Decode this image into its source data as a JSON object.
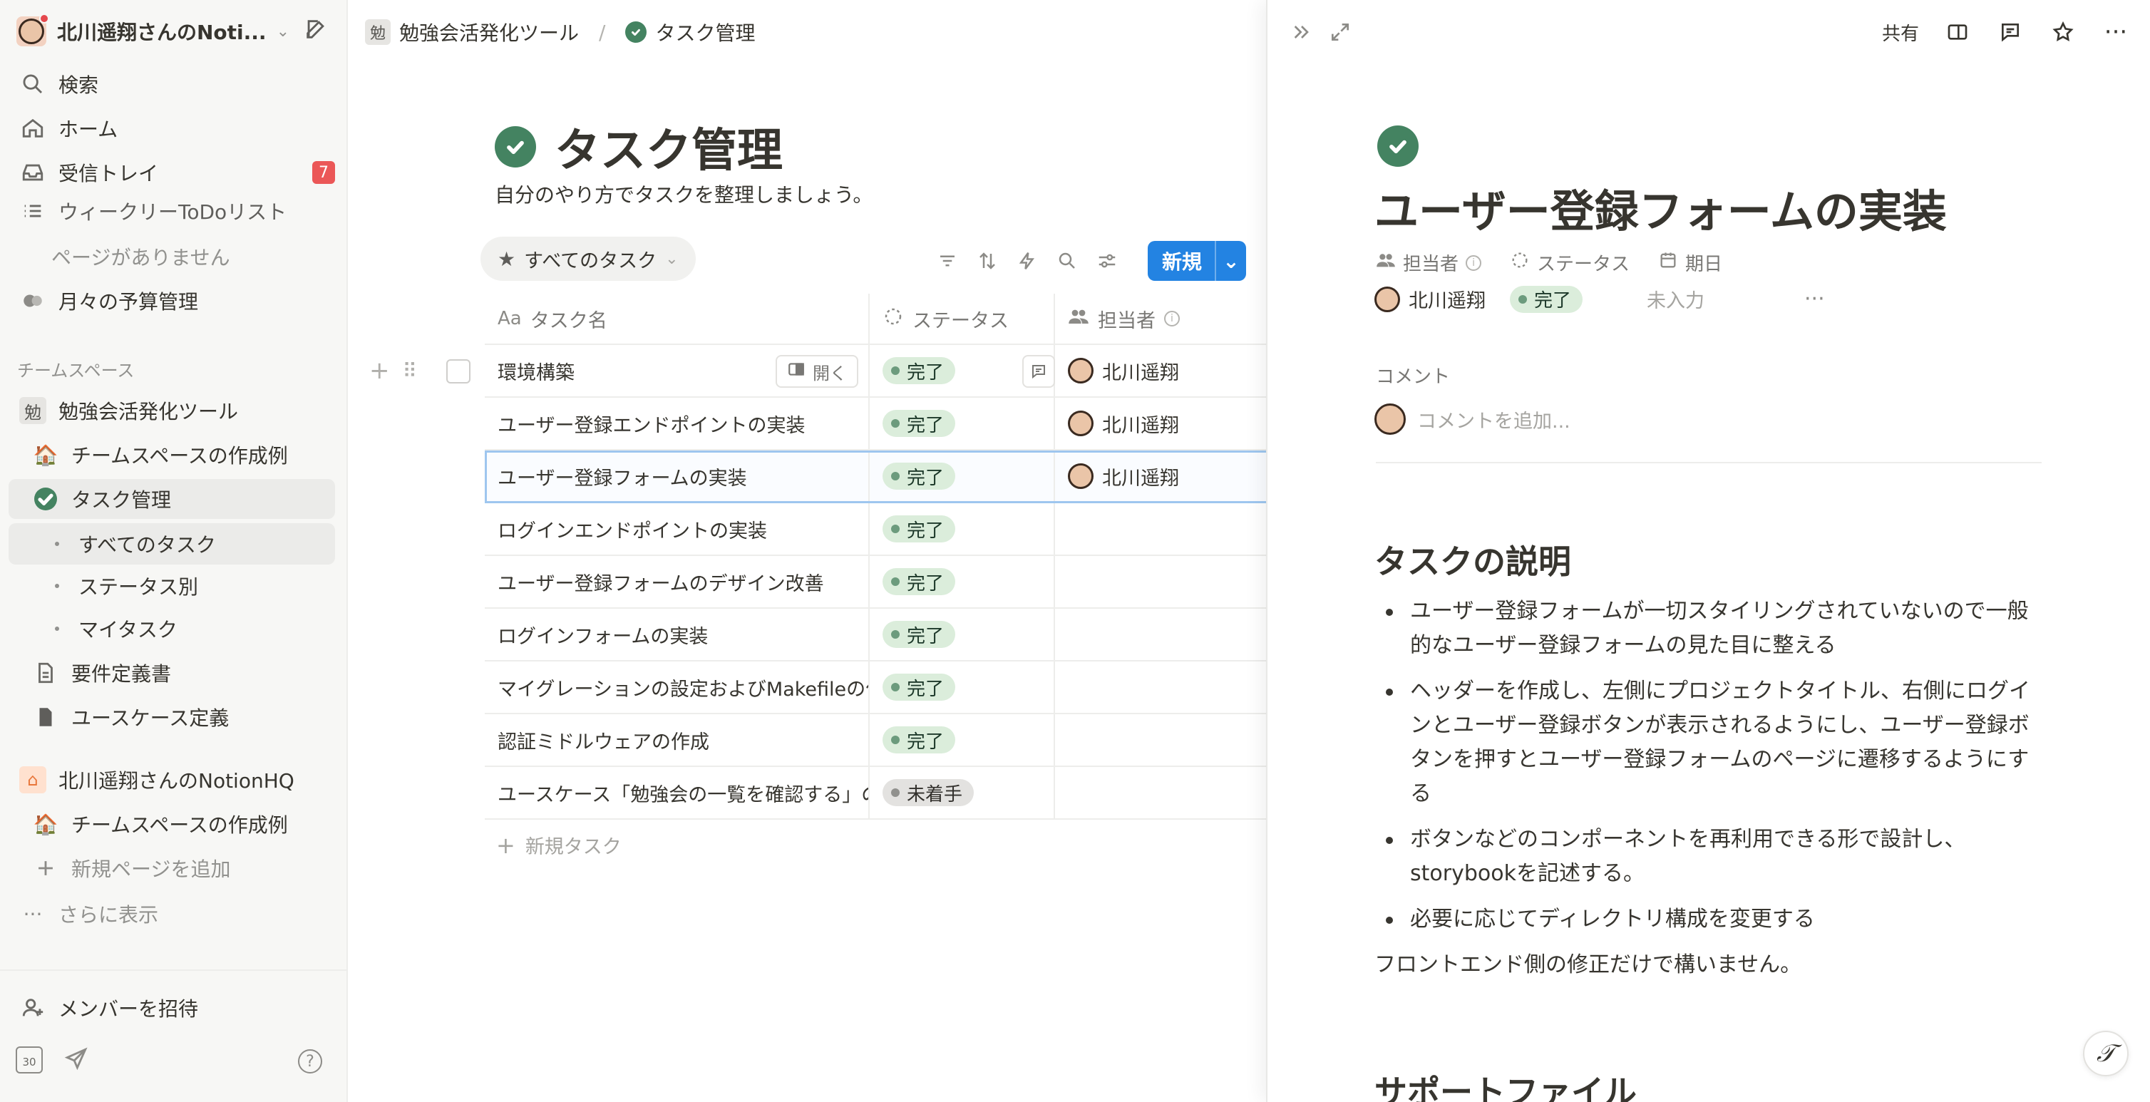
{
  "sidebar": {
    "workspace_name": "北川遥翔さんのNoti...",
    "top_items": [
      {
        "label": "検索",
        "icon": "search-icon"
      },
      {
        "label": "ホーム",
        "icon": "home-icon"
      },
      {
        "label": "受信トレイ",
        "icon": "inbox-icon",
        "badge": "7"
      }
    ],
    "private_items": [
      {
        "label": "ウィークリーToDoリスト"
      },
      {
        "label": "ページがありません"
      },
      {
        "label": "月々の予算管理"
      }
    ],
    "team_section_title": "チームスペース",
    "team_items": [
      {
        "label": "勉強会活発化ツール",
        "glyph": "勉"
      },
      {
        "label": "チームスペースの作成例"
      },
      {
        "label": "タスク管理"
      },
      {
        "label": "すべてのタスク"
      },
      {
        "label": "ステータス別"
      },
      {
        "label": "マイタスク"
      },
      {
        "label": "要件定義書"
      },
      {
        "label": "ユースケース定義"
      }
    ],
    "hq_items": [
      {
        "label": "北川遥翔さんのNotionHQ"
      },
      {
        "label": "チームスペースの作成例"
      },
      {
        "label": "新規ページを追加"
      },
      {
        "label": "さらに表示"
      }
    ],
    "invite_label": "メンバーを招待",
    "calendar_day": "30"
  },
  "main": {
    "breadcrumb": {
      "team": "勉強会活発化ツール",
      "team_glyph": "勉",
      "page": "タスク管理"
    },
    "title": "タスク管理",
    "description": "自分のやり方でタスクを整理しましょう。",
    "view_tab": "すべてのタスク",
    "new_button": "新規",
    "columns": [
      "タスク名",
      "ステータス",
      "担当者"
    ],
    "rows": [
      {
        "name": "環境構築",
        "status": "完了",
        "status_kind": "done",
        "assignee": "北川遥翔"
      },
      {
        "name": "ユーザー登録エンドポイントの実装",
        "status": "完了",
        "status_kind": "done",
        "assignee": "北川遥翔"
      },
      {
        "name": "ユーザー登録フォームの実装",
        "status": "完了",
        "status_kind": "done",
        "assignee": "北川遥翔"
      },
      {
        "name": "ログインエンドポイントの実装",
        "status": "完了",
        "status_kind": "done",
        "assignee": ""
      },
      {
        "name": "ユーザー登録フォームのデザイン改善",
        "status": "完了",
        "status_kind": "done",
        "assignee": ""
      },
      {
        "name": "ログインフォームの実装",
        "status": "完了",
        "status_kind": "done",
        "assignee": ""
      },
      {
        "name": "マイグレーションの設定およびMakefileの作",
        "status": "完了",
        "status_kind": "done",
        "assignee": ""
      },
      {
        "name": "認証ミドルウェアの作成",
        "status": "完了",
        "status_kind": "done",
        "assignee": ""
      },
      {
        "name": "ユースケース「勉強会の一覧を確認する」の",
        "status": "未着手",
        "status_kind": "todo",
        "assignee": ""
      }
    ],
    "open_label": "開く",
    "new_task_label": "新規タスク"
  },
  "panel": {
    "share_label": "共有",
    "title": "ユーザー登録フォームの実装",
    "prop_labels": {
      "assignee": "担当者",
      "status": "ステータス",
      "due": "期日"
    },
    "assignee": "北川遥翔",
    "status": "完了",
    "due_placeholder": "未入力",
    "comment_label": "コメント",
    "comment_placeholder": "コメントを追加...",
    "section_heading": "タスクの説明",
    "bullets": [
      "ユーザー登録フォームが一切スタイリングされていないので一般的なユーザー登録フォームの見た目に整える",
      "ヘッダーを作成し、左側にプロジェクトタイトル、右側にログインとユーザー登録ボタンが表示されるようにし、ユーザー登録ボタンを押すとユーザー登録フォームのページに遷移するようにする",
      "ボタンなどのコンポーネントを再利用できる形で設計し、storybookを記述する。",
      "必要に応じてディレクトリ構成を変更する"
    ],
    "paragraph": "フロントエンド側の修正だけで構いません。",
    "next_heading": "サポートファイル"
  },
  "colors": {
    "accent": "#2383e2",
    "done_bg": "#dbeddb",
    "todo_bg": "#e3e2e0",
    "check_green": "#448361",
    "badge_red": "#eb5757"
  }
}
